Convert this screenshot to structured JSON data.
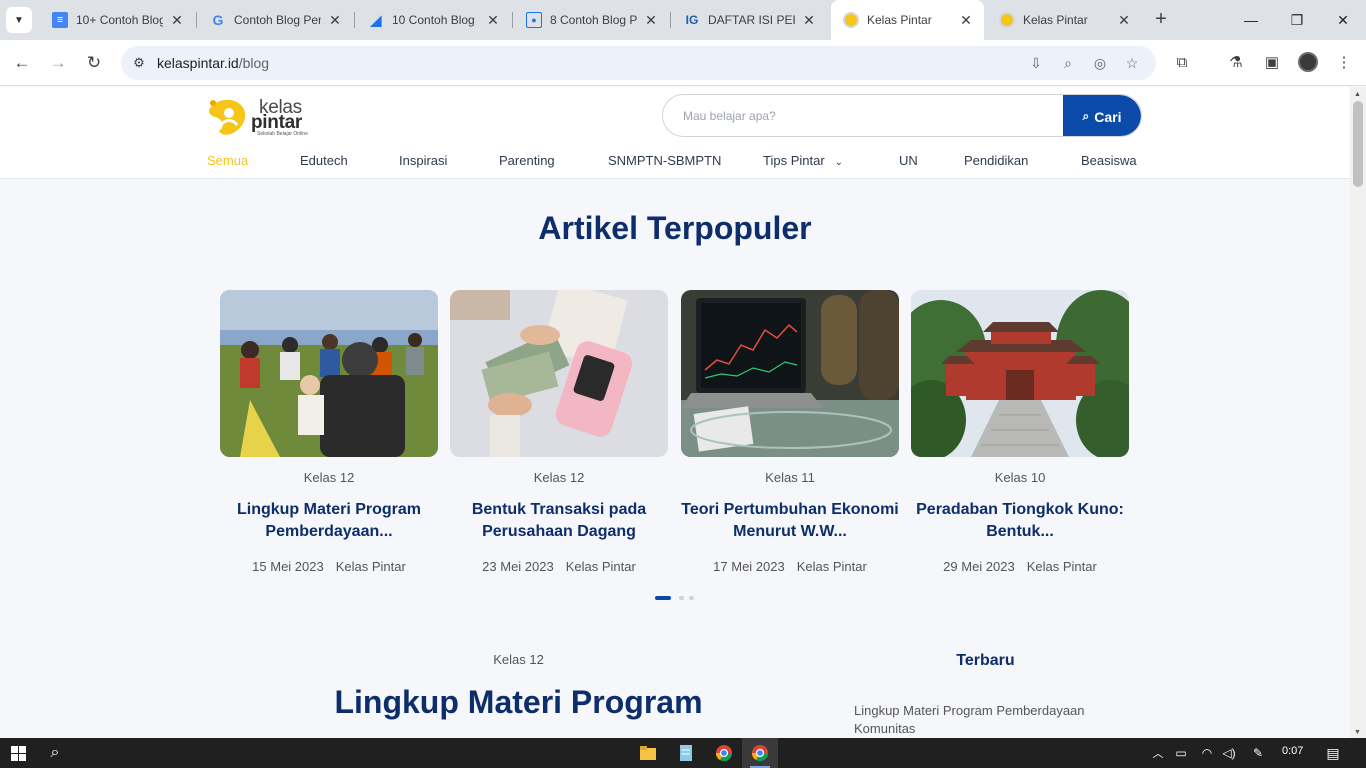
{
  "browser": {
    "tabs": [
      {
        "title": "10+ Contoh Blog",
        "icon": "docs-icon",
        "icon_color": "#4285f4"
      },
      {
        "title": "Contoh Blog Pen",
        "icon": "google-icon",
        "icon_color": "#4285f4"
      },
      {
        "title": "10 Contoh Blog",
        "icon": "bookmark-icon",
        "icon_color": "#1a73e8"
      },
      {
        "title": "8 Contoh Blog P",
        "icon": "person-icon",
        "icon_color": "#1a73e8"
      },
      {
        "title": "DAFTAR ISI PERA",
        "icon": "ig-icon",
        "icon_color": "#1a5fb4"
      },
      {
        "title": "Kelas Pintar",
        "icon": "kelaspintar-icon",
        "icon_color": "#f5c518"
      },
      {
        "title": "Kelas Pintar",
        "icon": "kelaspintar-icon",
        "icon_color": "#f5c518"
      }
    ],
    "active_tab": 5,
    "url_host": "kelaspintar.id",
    "url_path": "/blog"
  },
  "site": {
    "logo_kelas": "kelas",
    "logo_pintar": "pintar",
    "logo_tagline": "Sekolah Belajar Online",
    "search_placeholder": "Mau belajar apa?",
    "search_button": "Cari",
    "categories": [
      "Semua",
      "Edutech",
      "Inspirasi",
      "Parenting",
      "SNMPTN-SBMPTN",
      "Tips Pintar",
      "UN",
      "Pendidikan",
      "Beasiswa"
    ],
    "active_category": "Semua",
    "accent_color": "#f5c518",
    "brand_blue": "#0b4aa8",
    "title_color": "#0d2d6b"
  },
  "popular": {
    "title": "Artikel Terpopuler",
    "cards": [
      {
        "kelas": "Kelas 12",
        "title": "Lingkup Materi Program Pemberdayaan...",
        "date": "15 Mei 2023",
        "author": "Kelas Pintar"
      },
      {
        "kelas": "Kelas 12",
        "title": "Bentuk Transaksi pada Perusahaan Dagang",
        "date": "23 Mei 2023",
        "author": "Kelas Pintar"
      },
      {
        "kelas": "Kelas 11",
        "title": "Teori Pertumbuhan Ekonomi Menurut W.W...",
        "date": "17 Mei 2023",
        "author": "Kelas Pintar"
      },
      {
        "kelas": "Kelas 10",
        "title": "Peradaban Tiongkok Kuno: Bentuk...",
        "date": "29 Mei 2023",
        "author": "Kelas Pintar"
      }
    ],
    "carousel_page": 1,
    "carousel_pages": 3
  },
  "featured": {
    "kelas": "Kelas 12",
    "title": "Lingkup Materi Program"
  },
  "sidebar": {
    "title": "Terbaru",
    "items": [
      "Lingkup Materi Program Pemberdayaan Komunitas"
    ]
  },
  "taskbar": {
    "time": "0:07"
  }
}
